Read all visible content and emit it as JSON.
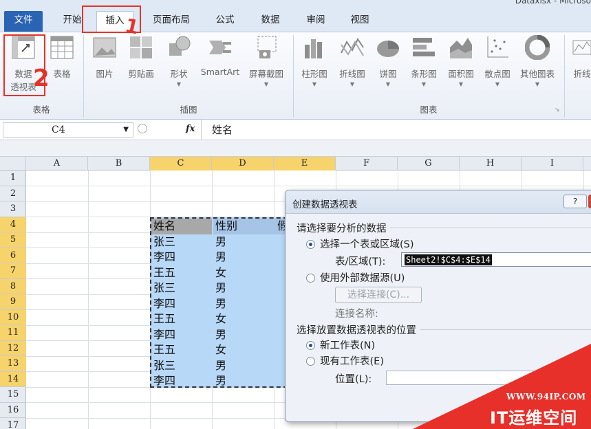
{
  "window": {
    "title_fragment": "Dataxlsx - Microso"
  },
  "tabs": [
    {
      "label": "文件"
    },
    {
      "label": "开始"
    },
    {
      "label": "插入"
    },
    {
      "label": "页面布局"
    },
    {
      "label": "公式"
    },
    {
      "label": "数据"
    },
    {
      "label": "审阅"
    },
    {
      "label": "视图"
    }
  ],
  "ribbon": {
    "groups": {
      "tables": "表格",
      "illustrations": "插图",
      "charts": "图表"
    },
    "buttons": {
      "pivot_line1": "数据",
      "pivot_line2": "透视表",
      "table": "表格",
      "picture": "图片",
      "clipart": "剪贴画",
      "shapes": "形状",
      "smartart": "SmartArt",
      "screenshot": "屏幕截图",
      "column": "柱形图",
      "line": "折线图",
      "pie": "饼图",
      "bar": "条形图",
      "area": "面积图",
      "scatter": "散点图",
      "other": "其他图表",
      "sparkline": "折线"
    }
  },
  "formula_bar": {
    "name_box": "C4",
    "fx": "fx",
    "value": "姓名"
  },
  "grid": {
    "columns": [
      "A",
      "B",
      "C",
      "D",
      "E",
      "F",
      "G",
      "H",
      "I"
    ],
    "rows": [
      "1",
      "2",
      "3",
      "4",
      "5",
      "6",
      "7",
      "8",
      "9",
      "10",
      "11",
      "12",
      "13",
      "14",
      "15",
      "16",
      "17"
    ],
    "headers": {
      "name": "姓名",
      "gender": "性别",
      "third": "假"
    },
    "data": [
      {
        "name": "张三",
        "gender": "男"
      },
      {
        "name": "李四",
        "gender": "男"
      },
      {
        "name": "王五",
        "gender": "女"
      },
      {
        "name": "张三",
        "gender": "男"
      },
      {
        "name": "李四",
        "gender": "男"
      },
      {
        "name": "王五",
        "gender": "女"
      },
      {
        "name": "李四",
        "gender": "男"
      },
      {
        "name": "王五",
        "gender": "女"
      },
      {
        "name": "张三",
        "gender": "男"
      },
      {
        "name": "李四",
        "gender": "男"
      }
    ]
  },
  "dialog": {
    "title": "创建数据透视表",
    "help": "?",
    "section1": "请选择要分析的数据",
    "opt_range": "选择一个表或区域(S)",
    "range_label": "表/区域(T):",
    "range_value": "Sheet2!$C$4:$E$14",
    "opt_external": "使用外部数据源(U)",
    "choose_conn": "选择连接(C)...",
    "conn_name": "连接名称:",
    "section2": "选择放置数据透视表的位置",
    "opt_new": "新工作表(N)",
    "opt_existing": "现有工作表(E)",
    "loc_label": "位置(L):"
  },
  "annotations": {
    "step1": "1",
    "step2": "2"
  },
  "watermark": {
    "url": "WWW.94IP.COM",
    "brand": "IT运维空间"
  },
  "colors": {
    "accent": "#2a64b5",
    "highlight": "#f6d36b",
    "selection": "#b8d8f8",
    "annotation": "#e53228"
  }
}
